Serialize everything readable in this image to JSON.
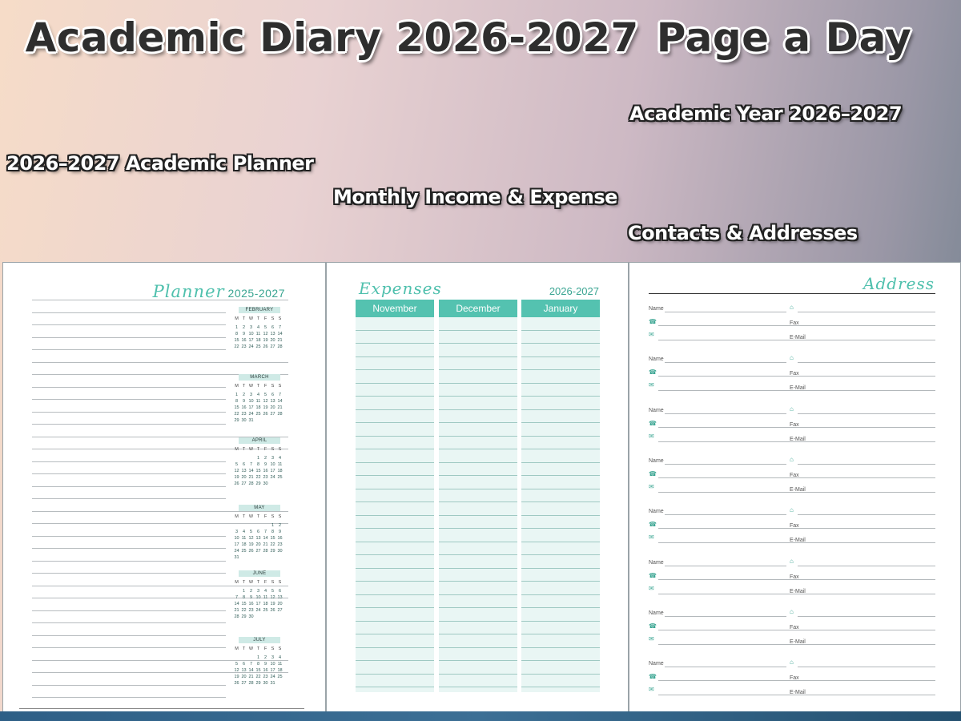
{
  "hero": {
    "title_part1": "Academic Diary 2026-2027",
    "title_part2": "Page a Day"
  },
  "taglines": {
    "academic_year": "Academic Year 2026–2027",
    "academic_planner": "2026–2027 Academic Planner",
    "income_expense": "Monthly Income & Expense",
    "contacts": "Contacts & Addresses"
  },
  "planner_page": {
    "script_title": "Planner",
    "year": "2025-2027",
    "weekdays": [
      "M",
      "T",
      "W",
      "T",
      "F",
      "S",
      "S"
    ],
    "months": [
      {
        "name": "FEBRUARY",
        "days": [
          "1",
          "2",
          "3",
          "4",
          "5",
          "6",
          "7",
          "8",
          "9",
          "10",
          "11",
          "12",
          "13",
          "14",
          "15",
          "16",
          "17",
          "18",
          "19",
          "20",
          "21",
          "22",
          "23",
          "24",
          "25",
          "26",
          "27",
          "28"
        ],
        "offset": 0
      },
      {
        "name": "MARCH",
        "days": [
          "1",
          "2",
          "3",
          "4",
          "5",
          "6",
          "7",
          "8",
          "9",
          "10",
          "11",
          "12",
          "13",
          "14",
          "15",
          "16",
          "17",
          "18",
          "19",
          "20",
          "21",
          "22",
          "23",
          "24",
          "25",
          "26",
          "27",
          "28",
          "29",
          "30",
          "31"
        ],
        "offset": 0
      },
      {
        "name": "APRIL",
        "days": [
          "1",
          "2",
          "3",
          "4",
          "5",
          "6",
          "7",
          "8",
          "9",
          "10",
          "11",
          "12",
          "13",
          "14",
          "15",
          "16",
          "17",
          "18",
          "19",
          "20",
          "21",
          "22",
          "23",
          "24",
          "25",
          "26",
          "27",
          "28",
          "29",
          "30"
        ],
        "offset": 3
      },
      {
        "name": "MAY",
        "days": [
          "1",
          "2",
          "3",
          "4",
          "5",
          "6",
          "7",
          "8",
          "9",
          "10",
          "11",
          "12",
          "13",
          "14",
          "15",
          "16",
          "17",
          "18",
          "19",
          "20",
          "21",
          "22",
          "23",
          "24",
          "25",
          "26",
          "27",
          "28",
          "29",
          "30",
          "31"
        ],
        "offset": 5
      },
      {
        "name": "JUNE",
        "days": [
          "1",
          "2",
          "3",
          "4",
          "5",
          "6",
          "7",
          "8",
          "9",
          "10",
          "11",
          "12",
          "13",
          "14",
          "15",
          "16",
          "17",
          "18",
          "19",
          "20",
          "21",
          "22",
          "23",
          "24",
          "25",
          "26",
          "27",
          "28",
          "29",
          "30"
        ],
        "offset": 1
      },
      {
        "name": "JULY",
        "days": [
          "1",
          "2",
          "3",
          "4",
          "5",
          "6",
          "7",
          "8",
          "9",
          "10",
          "11",
          "12",
          "13",
          "14",
          "15",
          "16",
          "17",
          "18",
          "19",
          "20",
          "21",
          "22",
          "23",
          "24",
          "25",
          "26",
          "27",
          "28",
          "29",
          "30",
          "31"
        ],
        "offset": 3
      }
    ]
  },
  "expenses_page": {
    "script_title": "Expenses",
    "year": "2026-2027",
    "columns": [
      "November",
      "December",
      "January"
    ]
  },
  "address_page": {
    "script_title": "Address",
    "labels": {
      "name": "Name",
      "fax": "Fax",
      "email": "E-Mail"
    }
  },
  "colors": {
    "accent": "#54c2b0",
    "accent_light": "#e9f6f4",
    "title_dark": "#2e2e2e"
  }
}
